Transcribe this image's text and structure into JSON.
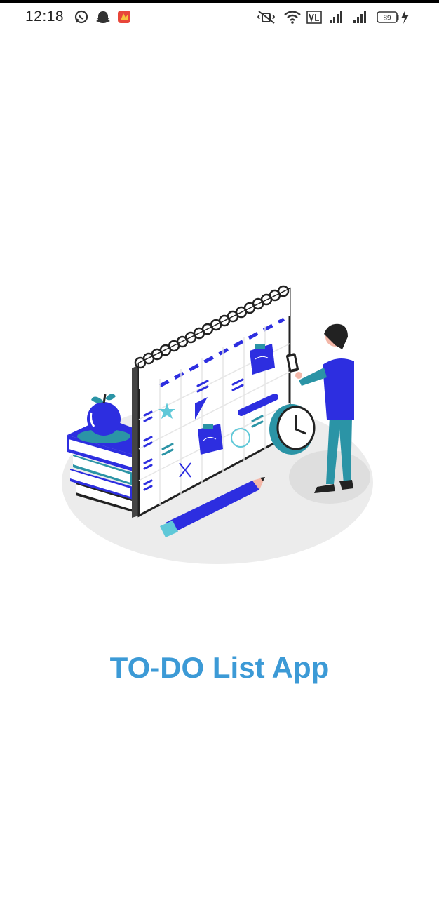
{
  "status_bar": {
    "time": "12:18",
    "battery_level": "89",
    "left_icons": [
      "whatsapp-icon",
      "snapchat-icon",
      "app-notification-icon"
    ],
    "right_icons": [
      "vibrate-icon",
      "wifi-icon",
      "volte-icon",
      "signal-icon",
      "signal-icon",
      "battery-icon",
      "charging-icon"
    ]
  },
  "splash": {
    "illustration": "calendar-planner-illustration",
    "app_title": "TO-DO List App"
  },
  "colors": {
    "title": "#3c9ad6",
    "accent_blue": "#2d2ee0",
    "accent_teal": "#2b94a6",
    "background": "#ffffff"
  }
}
